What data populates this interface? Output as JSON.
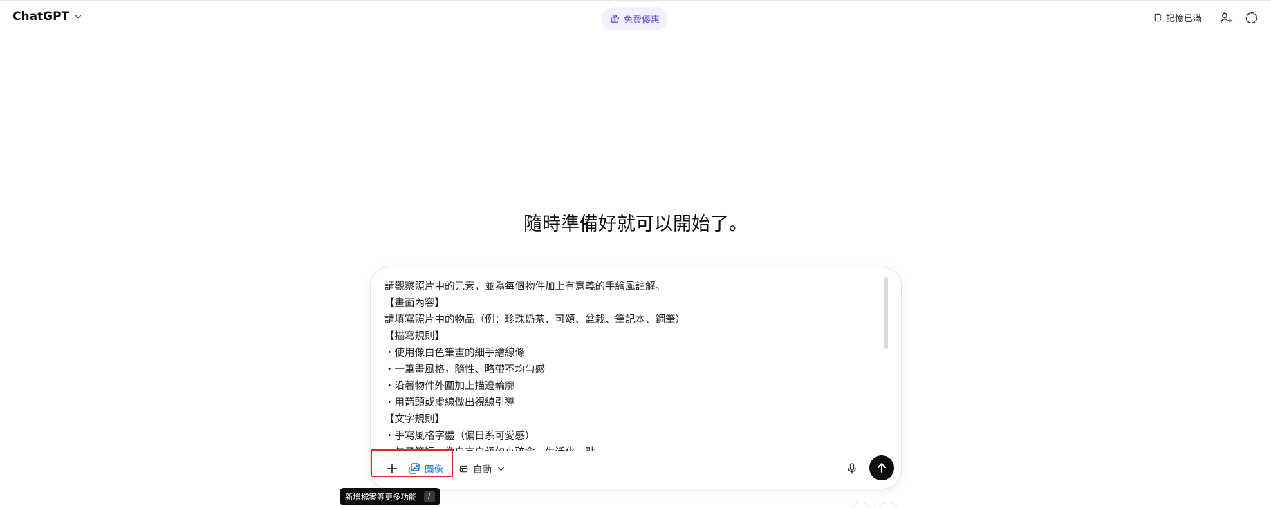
{
  "header": {
    "app_title": "ChatGPT",
    "promo_label": "免費優惠",
    "memory_label": "記憶已滿"
  },
  "main": {
    "heading": "隨時準備好就可以開始了。"
  },
  "composer": {
    "lines": [
      "請觀察照片中的元素，並為每個物件加上有意義的手繪風註解。",
      "【畫面內容】",
      "請填寫照片中的物品（例：珍珠奶茶、可頌、盆栽、筆記本、鋼筆）",
      "【描寫規則】",
      "・使用像白色筆畫的細手繪線條",
      "・一筆畫風格，隨性、略帶不均勻感",
      "・沿著物件外圍加上描邊輪廓",
      "・用箭頭或虛線做出視線引導",
      "【文字規則】",
      "・手寫風格字體（偏日系可愛感）",
      "・句子簡短，像自言自語的小碎念、生活化一點"
    ],
    "image_label": "圖像",
    "auto_label": "自動"
  },
  "tooltip": {
    "text": "新增檔案等更多功能",
    "shortcut": "/"
  },
  "colors": {
    "accent_blue": "#1a73e8",
    "promo_purple": "#5b4fd1",
    "highlight_red": "#d9282f",
    "send_black": "#0d0d0d"
  },
  "icons": {
    "title_dropdown": "chevron-down-icon",
    "promo": "gift-icon",
    "memory": "memory-icon",
    "add_person": "add-person-icon",
    "temporary_chat": "dashed-circle-icon",
    "plus": "plus-icon",
    "image": "image-icon",
    "auto": "auto-mode-icon",
    "auto_dropdown": "chevron-down-icon",
    "mic": "microphone-icon",
    "send": "arrow-up-icon"
  }
}
